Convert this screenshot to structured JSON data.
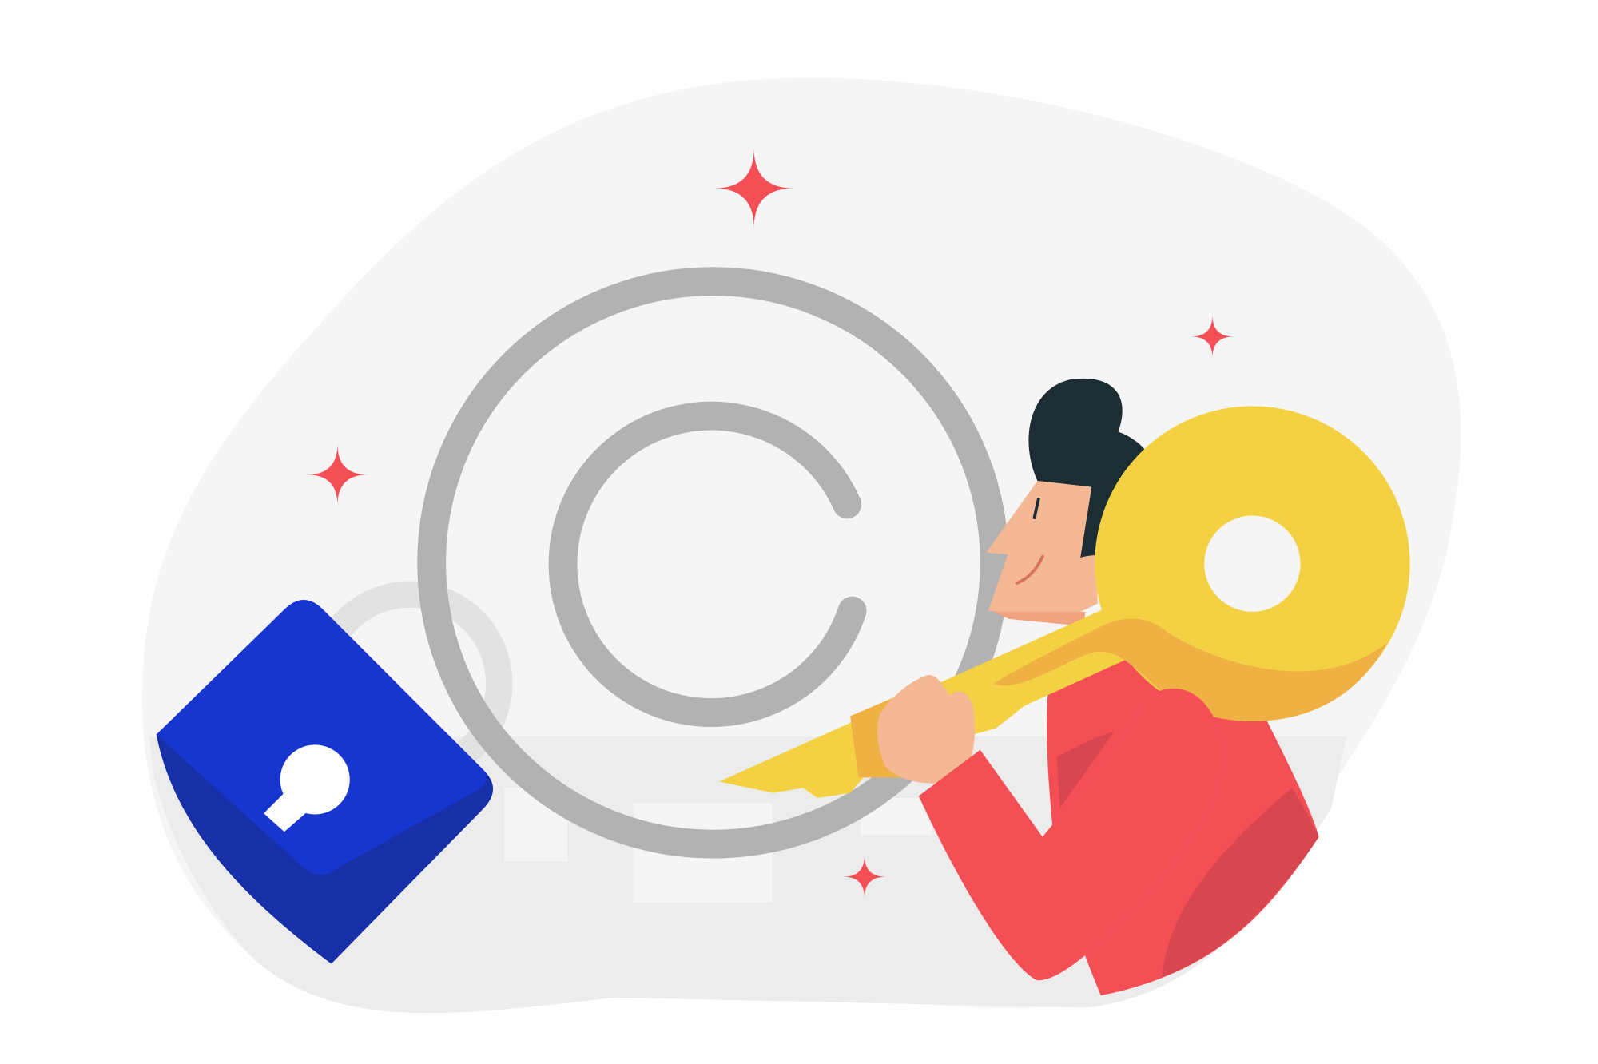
{
  "illustration": {
    "subject": "copyright-protection",
    "icons": [
      "copyright-icon",
      "padlock-icon",
      "key-icon",
      "sparkle-icon"
    ],
    "colors": {
      "background": "#ffffff",
      "blob": "#f5f5f5",
      "floor": "#ececec",
      "copyright_ring": "#b2b2b2",
      "shackle": "#e2e2e2",
      "lock_body": "#1736d0",
      "lock_shadow": "#1730a8",
      "key": "#f3d142",
      "key_shadow": "#f0b144",
      "shirt": "#f54f56",
      "shirt_shadow": "#d8464f",
      "skin": "#f5b895",
      "hair": "#1c2d33",
      "sparkle": "#f54f56"
    }
  }
}
